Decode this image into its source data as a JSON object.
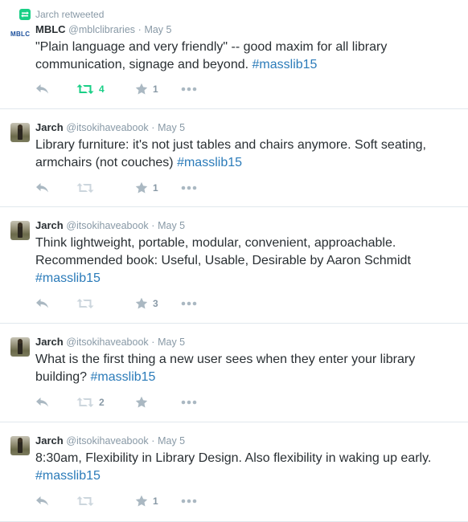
{
  "tweets": [
    {
      "context": "Jarch retweeted",
      "avatar_text": "MBLC",
      "name": "MBLC",
      "handle": "@mblclibraries",
      "separator": "·",
      "time": "May 5",
      "text": "\"Plain language and very friendly\" -- good maxim for all library communication, signage and beyond.",
      "hashtag": "#masslib15",
      "retweet_count": "4",
      "favorite_count": "1",
      "retweeted": true
    },
    {
      "context": "",
      "avatar_text": "",
      "name": "Jarch",
      "handle": "@itsokihaveabook",
      "separator": "·",
      "time": "May 5",
      "text": "Library furniture: it's not just tables and chairs anymore. Soft seating, armchairs (not couches)",
      "hashtag": "#masslib15",
      "retweet_count": "",
      "favorite_count": "1",
      "retweeted": false
    },
    {
      "context": "",
      "avatar_text": "",
      "name": "Jarch",
      "handle": "@itsokihaveabook",
      "separator": "·",
      "time": "May 5",
      "text": "Think lightweight, portable, modular, convenient, approachable. Recommended book: Useful, Usable, Desirable by Aaron Schmidt",
      "hashtag": "#masslib15",
      "retweet_count": "",
      "favorite_count": "3",
      "retweeted": false
    },
    {
      "context": "",
      "avatar_text": "",
      "name": "Jarch",
      "handle": "@itsokihaveabook",
      "separator": "·",
      "time": "May 5",
      "text": "What is the first thing a new user sees when they enter your library building?",
      "hashtag": "#masslib15",
      "retweet_count": "2",
      "favorite_count": "",
      "retweeted": false
    },
    {
      "context": "",
      "avatar_text": "",
      "name": "Jarch",
      "handle": "@itsokihaveabook",
      "separator": "·",
      "time": "May 5",
      "text": "8:30am, Flexibility in Library Design. Also flexibility in waking up early.",
      "hashtag": "#masslib15",
      "retweet_count": "",
      "favorite_count": "1",
      "retweeted": false
    }
  ],
  "colors": {
    "text": "#292f33",
    "muted": "#8899a6",
    "hashtag": "#2b7bb9",
    "retweet_active": "#19cf86",
    "icon": "#aab8c2",
    "divider": "#e1e8ed"
  },
  "icons": [
    "retweet-icon",
    "reply-icon",
    "favorite-icon",
    "more-icon"
  ]
}
